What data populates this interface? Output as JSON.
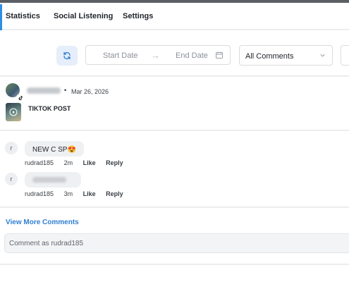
{
  "tabs": [
    {
      "label": "Statistics",
      "active": true
    },
    {
      "label": "Social Listening",
      "active": false
    },
    {
      "label": "Settings",
      "active": false
    }
  ],
  "filters": {
    "refresh_icon": "refresh-icon",
    "start_date_placeholder": "Start Date",
    "arrow": "→",
    "end_date_placeholder": "End Date",
    "calendar_icon": "calendar-icon",
    "comment_filter_value": "All Comments"
  },
  "post": {
    "date": "Mar 26, 2026",
    "separator": "•",
    "type_label": "TIKTOK POST",
    "platform_icon": "tiktok-icon"
  },
  "comments": [
    {
      "avatar_letter": "r",
      "text": "NEW C SP😍",
      "author": "rudrad185",
      "time": "2m",
      "like_label": "Like",
      "reply_label": "Reply"
    },
    {
      "avatar_letter": "r",
      "text": "",
      "author": "rudrad185",
      "time": "3m",
      "like_label": "Like",
      "reply_label": "Reply"
    }
  ],
  "view_more_label": "View More Comments",
  "comment_input_placeholder": "Comment as rudrad185",
  "colors": {
    "accent": "#2f7fd0",
    "active_tab_marker": "#2f8de4",
    "refresh_bg": "#e6eefb"
  }
}
